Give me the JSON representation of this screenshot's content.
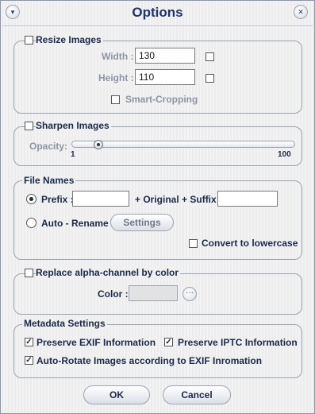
{
  "window": {
    "title": "Options",
    "menu_glyph": "▾",
    "close_glyph": "✕"
  },
  "resize": {
    "legend": "Resize Images",
    "checked": false,
    "width_label": "Width :",
    "width_value": "130",
    "height_label": "Height :",
    "height_value": "110",
    "smart_label": "Smart-Cropping"
  },
  "sharpen": {
    "legend": "Sharpen Images",
    "checked": false,
    "opacity_label": "Opacity:",
    "min_label": "1",
    "max_label": "100",
    "level": 0.12
  },
  "filenames": {
    "legend": "File Names",
    "prefix_label": "Prefix :",
    "prefix_value": "",
    "middle_label": "+ Original + Suffix :",
    "suffix_value": "",
    "auto_label": "Auto - Rename",
    "settings_label": "Settings",
    "lowercase_label": "Convert to lowercase",
    "selected": "prefix"
  },
  "alpha": {
    "legend": "Replace alpha-channel by color",
    "checked": false,
    "color_label": "Color :",
    "color_value": "#e2e2e2",
    "dots_glyph": "···"
  },
  "metadata": {
    "legend": "Metadata Settings",
    "exif_label": "Preserve EXIF Information",
    "iptc_label": "Preserve IPTC Information",
    "rotate_label": "Auto-Rotate Images according to EXIF Inromation",
    "check_glyph": "✓"
  },
  "buttons": {
    "ok": "OK",
    "cancel": "Cancel"
  }
}
